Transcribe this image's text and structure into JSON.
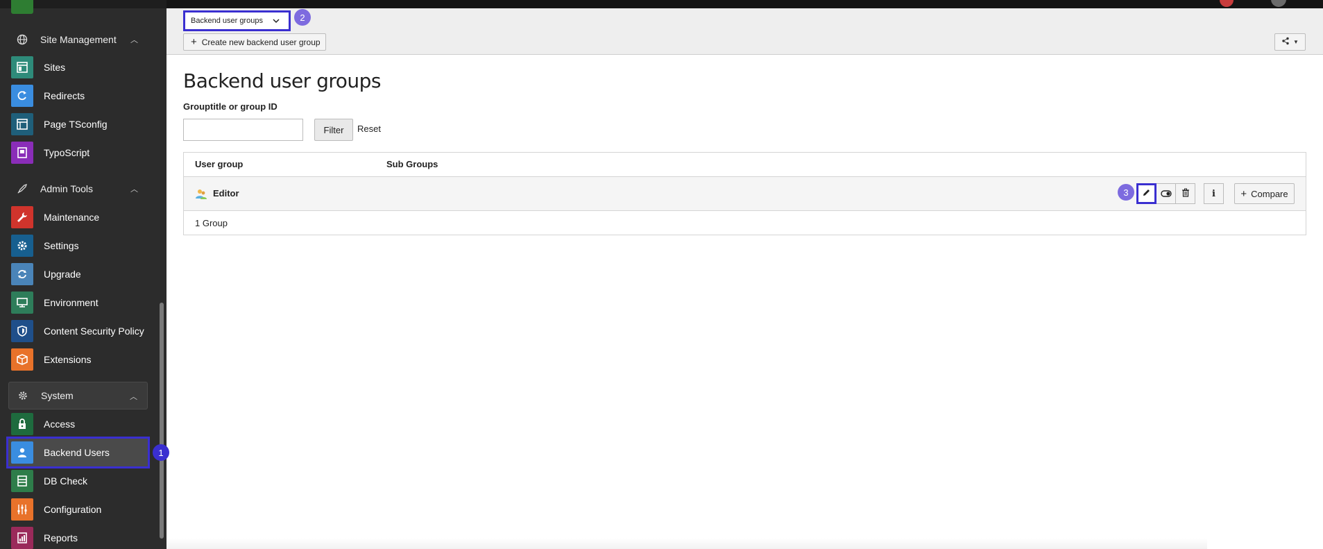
{
  "sidebar": {
    "groups": [
      {
        "label": "Site Management",
        "icon": "globe-icon"
      },
      {
        "label": "Admin Tools",
        "icon": "rocket-icon"
      },
      {
        "label": "System",
        "icon": "gear-icon"
      }
    ],
    "items": [
      {
        "label": "Sites",
        "color": "#2e8b7a",
        "icon": "sites-icon"
      },
      {
        "label": "Redirects",
        "color": "#3a8de0",
        "icon": "redirect-icon"
      },
      {
        "label": "Page TSconfig",
        "color": "#1f5f7a",
        "icon": "tsconfig-icon"
      },
      {
        "label": "TypoScript",
        "color": "#8a2db8",
        "icon": "typoscript-icon"
      },
      {
        "label": "Maintenance",
        "color": "#d0342c",
        "icon": "wrench-icon"
      },
      {
        "label": "Settings",
        "color": "#175f8f",
        "icon": "gear-icon"
      },
      {
        "label": "Upgrade",
        "color": "#4a84b8",
        "icon": "refresh-icon"
      },
      {
        "label": "Environment",
        "color": "#2e7d5a",
        "icon": "monitor-icon"
      },
      {
        "label": "Content Security Policy",
        "color": "#1f4f8a",
        "icon": "shield-icon"
      },
      {
        "label": "Extensions",
        "color": "#e8722a",
        "icon": "box-icon"
      },
      {
        "label": "Access",
        "color": "#1e6b3e",
        "icon": "lock-icon"
      },
      {
        "label": "Backend Users",
        "color": "#3a8de0",
        "icon": "user-icon"
      },
      {
        "label": "DB Check",
        "color": "#2e7d4a",
        "icon": "database-icon"
      },
      {
        "label": "Configuration",
        "color": "#e8722a",
        "icon": "sliders-icon"
      },
      {
        "label": "Reports",
        "color": "#9a2a5a",
        "icon": "report-icon"
      }
    ]
  },
  "markers": {
    "m1": "1",
    "m2": "2",
    "m3": "3"
  },
  "docheader": {
    "module_select": "Backend user groups",
    "create_label": "Create new backend user group"
  },
  "content": {
    "title": "Backend user groups",
    "filter_label": "Grouptitle or group ID",
    "filter_placeholder": "",
    "filter_button": "Filter",
    "reset_link": "Reset",
    "table": {
      "col_user_group": "User group",
      "col_sub_groups": "Sub Groups",
      "rows": [
        {
          "name": "Editor"
        }
      ],
      "footer": "1 Group"
    },
    "compare_label": "Compare"
  }
}
